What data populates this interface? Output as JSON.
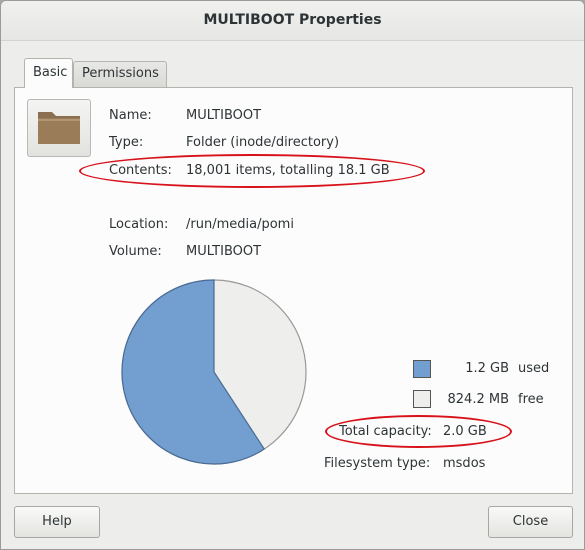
{
  "window": {
    "title": "MULTIBOOT Properties"
  },
  "tabs": [
    {
      "label": "Basic",
      "active": true
    },
    {
      "label": "Permissions",
      "active": false
    }
  ],
  "info": {
    "name_label": "Name:",
    "name_value": "MULTIBOOT",
    "type_label": "Type:",
    "type_value": "Folder (inode/directory)",
    "contents_label": "Contents:",
    "contents_value": "18,001 items, totalling 18.1 GB",
    "location_label": "Location:",
    "location_value": "/run/media/pomi",
    "volume_label": "Volume:",
    "volume_value": "MULTIBOOT"
  },
  "usage": {
    "used_size": "1.2 GB",
    "used_label": "used",
    "free_size": "824.2 MB",
    "free_label": "free",
    "capacity_label": "Total capacity:",
    "capacity_value": "2.0 GB",
    "fstype_label": "Filesystem type:",
    "fstype_value": "msdos",
    "used_fraction": 0.592,
    "used_color": "#729fcf",
    "free_color": "#eeeeec"
  },
  "buttons": {
    "help": "Help",
    "close": "Close"
  }
}
